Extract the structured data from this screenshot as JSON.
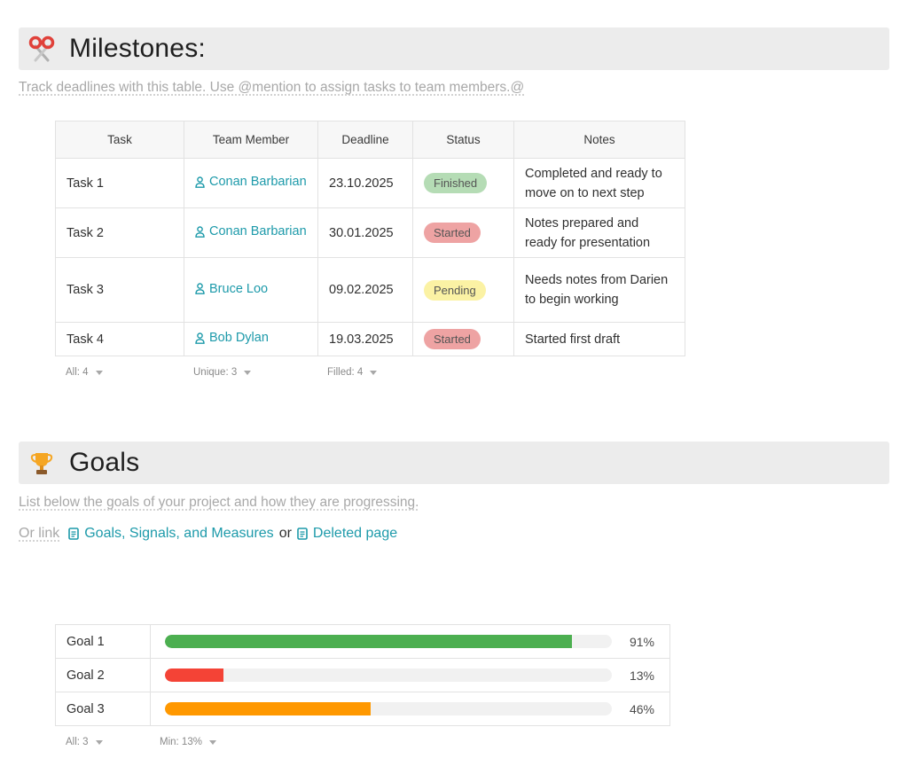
{
  "milestones": {
    "title": "Milestones:",
    "icon": "scissors-icon",
    "hint": "Track deadlines with this table. Use @mention to assign tasks to team members.@",
    "columns": [
      "Task",
      "Team Member",
      "Deadline",
      "Status",
      "Notes"
    ],
    "rows": [
      {
        "task": "Task 1",
        "member": "Conan Barbarian",
        "deadline": "23.10.2025",
        "status": "Finished",
        "status_color": "#b5dcb5",
        "notes": "Completed and ready to move on to next step"
      },
      {
        "task": "Task 2",
        "member": "Conan Barbarian",
        "deadline": "30.01.2025",
        "status": "Started",
        "status_color": "#eea3a3",
        "notes": "Notes prepared and ready for presentation"
      },
      {
        "task": "Task 3",
        "member": "Bruce Loo",
        "deadline": "09.02.2025",
        "status": "Pending",
        "status_color": "#fbf2a4",
        "notes": "Needs notes from Darien to begin working"
      },
      {
        "task": "Task 4",
        "member": "Bob Dylan",
        "deadline": "19.03.2025",
        "status": "Started",
        "status_color": "#eea3a3",
        "notes": "Started first draft"
      }
    ],
    "summaries": [
      "All: 4",
      "Unique: 3",
      "Filled: 4"
    ]
  },
  "goals": {
    "title": "Goals",
    "icon": "trophy-icon",
    "hint": "List below the goals of your project and how they are progressing.",
    "link_prefix": "Or link",
    "link1": "Goals, Signals, and Measures",
    "link_or": "or",
    "link2": "Deleted page",
    "items": [
      {
        "name": "Goal 1",
        "progress": 0.91,
        "label": "91%",
        "color": "#4caf50"
      },
      {
        "name": "Goal 2",
        "progress": 0.13,
        "label": "13%",
        "color": "#f44336"
      },
      {
        "name": "Goal 3",
        "progress": 0.46,
        "label": "46%",
        "color": "#ff9800"
      }
    ],
    "summaries": [
      "All: 3",
      "Min: 13%"
    ]
  },
  "colors": {
    "accent": "#1d9aaa",
    "heading_bg": "#ececec"
  }
}
